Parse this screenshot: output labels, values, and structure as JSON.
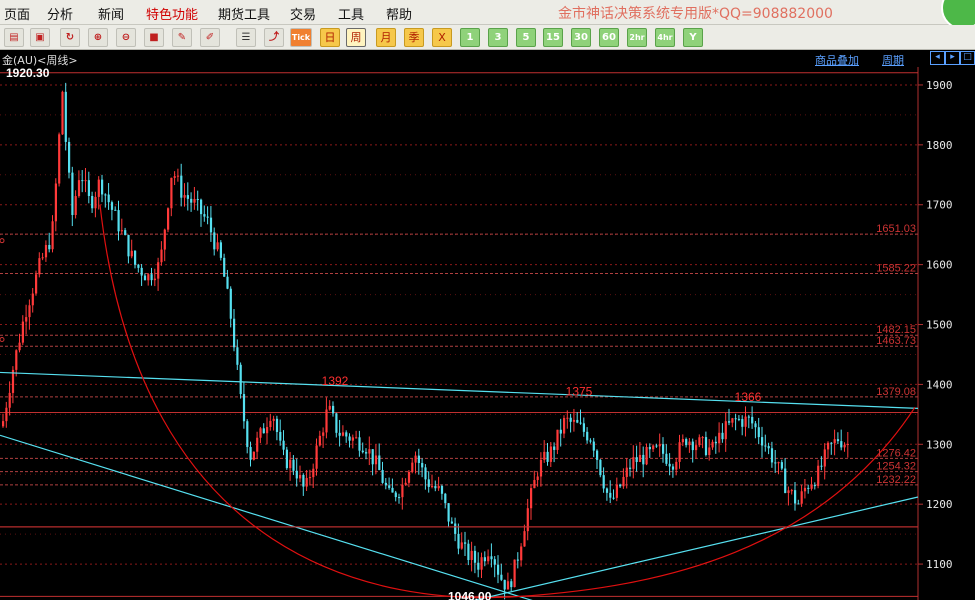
{
  "menubar": {
    "items": [
      "页面",
      "分析",
      "新闻",
      "特色功能",
      "期货工具",
      "交易",
      "工具",
      "帮助"
    ],
    "active": "特色功能",
    "brand": "金市神话决策系统专用版*QQ=908882000"
  },
  "toolbar": {
    "periods": [
      "日",
      "周",
      "月",
      "季",
      "X"
    ],
    "selected_period": "周",
    "minutes": [
      "1",
      "3",
      "5",
      "15",
      "30",
      "60",
      "2hr",
      "4hr",
      "Y"
    ],
    "tick_label": "Tick"
  },
  "infobar": {
    "title": "金(AU)<周线>",
    "overlay_link": "商品叠加",
    "period_link": "周期"
  },
  "chart_data": {
    "type": "candlestick",
    "title": "金(AU)<周线>",
    "ylim": [
      1040,
      1930
    ],
    "y_ticks": [
      1100,
      1200,
      1300,
      1400,
      1500,
      1600,
      1700,
      1800,
      1900
    ],
    "levels": [
      1651.03,
      1585.22,
      1482.15,
      1463.73,
      1379.08,
      1276.42,
      1254.32,
      1232.22
    ],
    "level_labels": [
      "1651.03",
      "1585.22",
      "1482.15",
      "1463.73",
      "1379.08",
      "1276.42",
      "1254.32",
      "1232.22"
    ],
    "extra_lines": [
      1920.3,
      1353,
      1162,
      1046
    ],
    "max_label": "1920.30",
    "min_label": "1046.00",
    "peaks": [
      {
        "label": "1392",
        "value": 1392
      },
      {
        "label": "1375",
        "value": 1375
      },
      {
        "label": "1366",
        "value": 1366
      }
    ],
    "colors": {
      "up": "#ff3a3a",
      "down": "#56e0f0",
      "grid": "#8a1818",
      "level": "#b04040",
      "trend": "#56e0f0",
      "arc": "#e01010"
    }
  }
}
